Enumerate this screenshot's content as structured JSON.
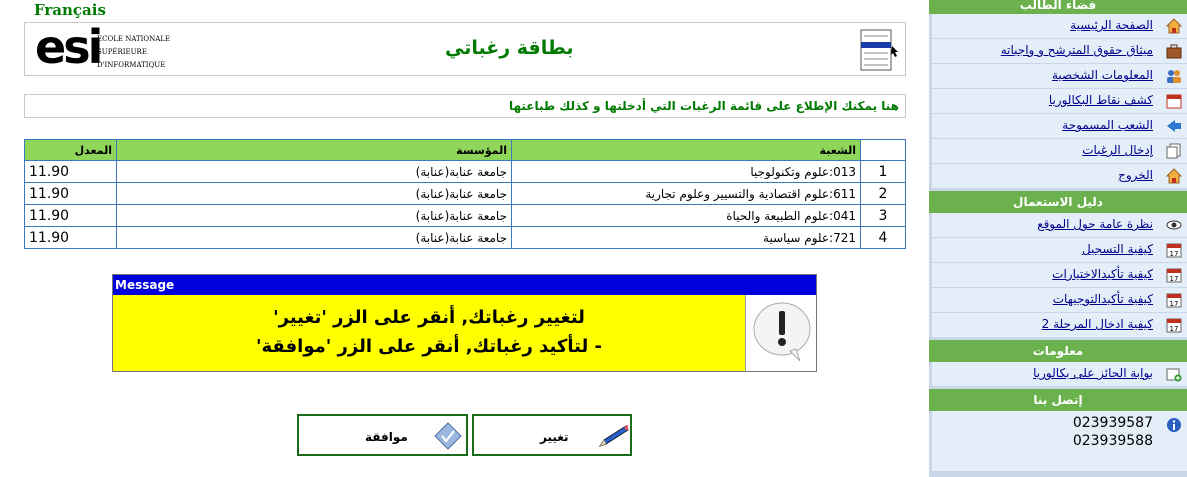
{
  "lang_link": "Français",
  "header": {
    "title": "بطاقة رغباتي",
    "logo_big": "esi",
    "logo_lines": [
      "ECOLE NATIONALE",
      "SUPÉRIEURE",
      "D'INFORMATIQUE"
    ]
  },
  "notice": "هنا يمكنك الإطلاع على قائمة الرغبات التي أدخلتها و كذلك طباعتها",
  "table": {
    "headers": {
      "filiere": "الشعبة",
      "etablissement": "المؤسسة",
      "moyenne": "المعدل"
    },
    "rows": [
      {
        "num": "1",
        "filiere": "013:علوم وتكنولوجيا",
        "etablissement": "جامعة عنابة(عنابة)",
        "moyenne": "11.90"
      },
      {
        "num": "2",
        "filiere": "611:علوم اقتصادية والتسيير وعلوم تجارية",
        "etablissement": "جامعة عنابة(عنابة)",
        "moyenne": "11.90"
      },
      {
        "num": "3",
        "filiere": "041:علوم الطبيعة والحياة",
        "etablissement": "جامعة عنابة(عنابة)",
        "moyenne": "11.90"
      },
      {
        "num": "4",
        "filiere": "721:علوم سياسية",
        "etablissement": "جامعة عنابة(عنابة)",
        "moyenne": "11.90"
      }
    ]
  },
  "message": {
    "title": "Message",
    "line1": "لتغيير رغباتك, أنقر على الزر 'تغيير'",
    "line2": "- لتأكيد رغباتك, أنقر على الزر 'موافقة'"
  },
  "buttons": {
    "confirm": "موافقة",
    "change": "تغيير"
  },
  "sidebar": {
    "student_space": {
      "title": "فضاء الطالب",
      "items": [
        {
          "label": "الصفحة الرئيسية",
          "icon": "home-icon"
        },
        {
          "label": "ميثاق حقوق المترشح و واجباته",
          "icon": "briefcase-icon"
        },
        {
          "label": "المعلومات الشخصية",
          "icon": "users-icon"
        },
        {
          "label": "كشف نقاط البكالوريا",
          "icon": "calendar-icon"
        },
        {
          "label": "الشعب المسموحة",
          "icon": "arrow-icon"
        },
        {
          "label": "إدخال الرغبات",
          "icon": "pages-icon"
        },
        {
          "label": "الخروج",
          "icon": "home-icon"
        }
      ]
    },
    "guide": {
      "title": "دليل الاستعمال",
      "items": [
        {
          "label": "نظرة عامة حول الموقع",
          "icon": "eye-icon"
        },
        {
          "label": "كيفية التسجيل",
          "icon": "calendar-17-icon"
        },
        {
          "label": "كيفية تأكيدالاختيارات",
          "icon": "calendar-17-icon"
        },
        {
          "label": "كيفية تأكيدالتوجيهات",
          "icon": "calendar-17-icon"
        },
        {
          "label": "كيفية ادخال المرحلة 2",
          "icon": "calendar-17-icon"
        }
      ]
    },
    "info": {
      "title": "معلومات",
      "items": [
        {
          "label": "بوابة الحائز على بكالوريا",
          "icon": "window-plus-icon"
        }
      ]
    },
    "contact": {
      "title": "إتصل بنا",
      "phones": [
        "023939587",
        "023939588"
      ]
    }
  },
  "colors": {
    "green_title": "#007a00",
    "table_header": "#8fd65a",
    "sidebar_head": "#6bb24e",
    "message_bg": "#ffff00",
    "message_head": "#0000dd"
  }
}
